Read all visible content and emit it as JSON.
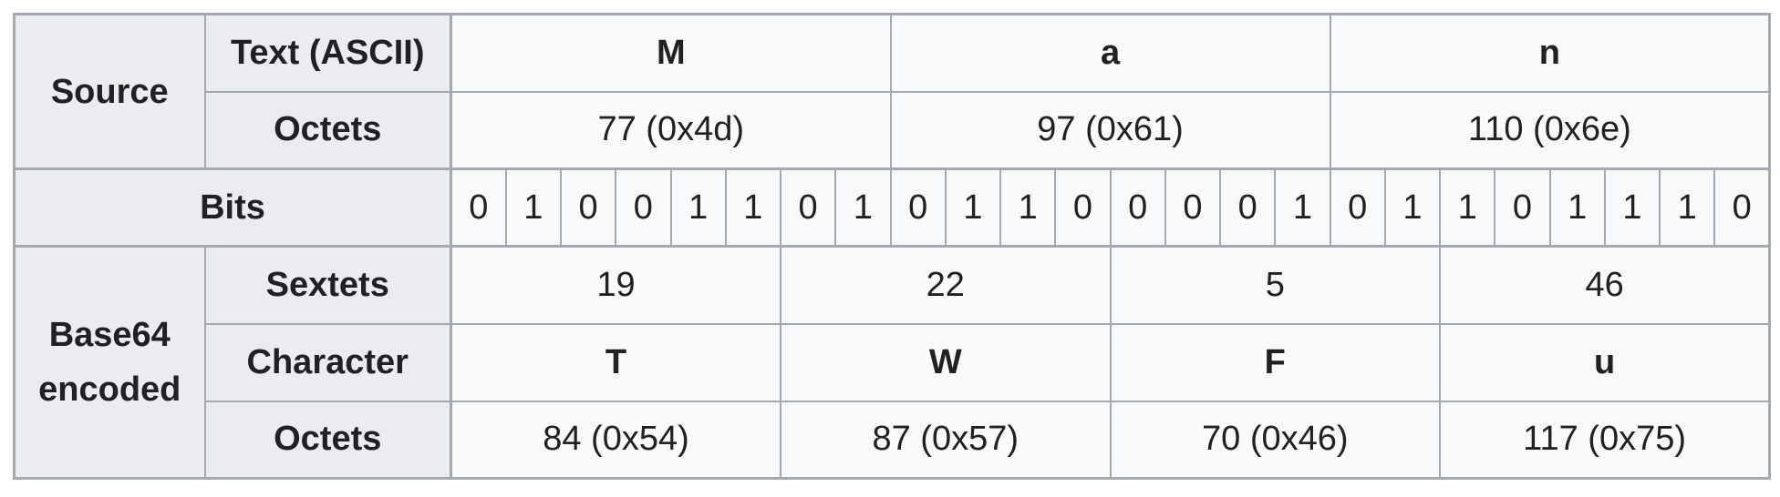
{
  "source": {
    "group_label": "Source",
    "text_row": {
      "label": "Text (ASCII)",
      "chars": [
        "M",
        "a",
        "n"
      ]
    },
    "octets_row": {
      "label": "Octets",
      "values": [
        "77 (0x4d)",
        "97 (0x61)",
        "110 (0x6e)"
      ]
    }
  },
  "bits": {
    "label": "Bits",
    "values": [
      "0",
      "1",
      "0",
      "0",
      "1",
      "1",
      "0",
      "1",
      "0",
      "1",
      "1",
      "0",
      "0",
      "0",
      "0",
      "1",
      "0",
      "1",
      "1",
      "0",
      "1",
      "1",
      "1",
      "0"
    ]
  },
  "encoded": {
    "group_label_line1": "Base64",
    "group_label_line2": "encoded",
    "sextets_row": {
      "label": "Sextets",
      "values": [
        "19",
        "22",
        "5",
        "46"
      ]
    },
    "character_row": {
      "label": "Character",
      "chars": [
        "T",
        "W",
        "F",
        "u"
      ]
    },
    "octets_row": {
      "label": "Octets",
      "values": [
        "84 (0x54)",
        "87 (0x57)",
        "70 (0x46)",
        "117 (0x75)"
      ]
    }
  }
}
